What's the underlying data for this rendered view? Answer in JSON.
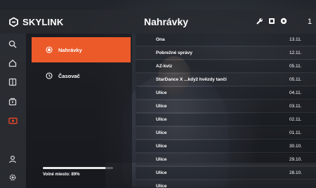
{
  "app": {
    "brand": "SKYLINK",
    "title": "Nahrávky",
    "clock": "1"
  },
  "colors": {
    "accent": "#ec5a2a",
    "rail_active_icon": "#e8462c"
  },
  "header_icons": [
    "wrench-icon",
    "stop-icon",
    "dot-icon"
  ],
  "rail": {
    "items": [
      {
        "name": "search-icon"
      },
      {
        "name": "home-icon"
      },
      {
        "name": "book-icon"
      },
      {
        "name": "archive-icon"
      },
      {
        "name": "recordings-icon",
        "active": true
      },
      {
        "name": "user-icon"
      },
      {
        "name": "settings-icon"
      }
    ]
  },
  "menu": {
    "items": [
      {
        "label": "Nahrávky",
        "icon": "radio-target-icon",
        "active": true
      },
      {
        "label": "Časovač",
        "icon": "clock-icon",
        "active": false
      }
    ],
    "free_space_label": "Volné miesto: 89%",
    "free_space_fraction": 0.11
  },
  "recordings": [
    {
      "title": "Ona",
      "date": "13.11."
    },
    {
      "title": "Pobrežné správy",
      "date": "12.11."
    },
    {
      "title": "AZ-kvíz",
      "date": "05.11."
    },
    {
      "title": "StarDance X ...když hvězdy tančí",
      "date": "05.11."
    },
    {
      "title": "Ulice",
      "date": "04.11."
    },
    {
      "title": "Ulice",
      "date": "03.11."
    },
    {
      "title": "Ulice",
      "date": "02.11."
    },
    {
      "title": "Ulice",
      "date": "01.11."
    },
    {
      "title": "Ulice",
      "date": "30.10."
    },
    {
      "title": "Ulice",
      "date": "29.10."
    },
    {
      "title": "Ulice",
      "date": "28.10."
    },
    {
      "title": "Ulice",
      "date": ""
    }
  ]
}
